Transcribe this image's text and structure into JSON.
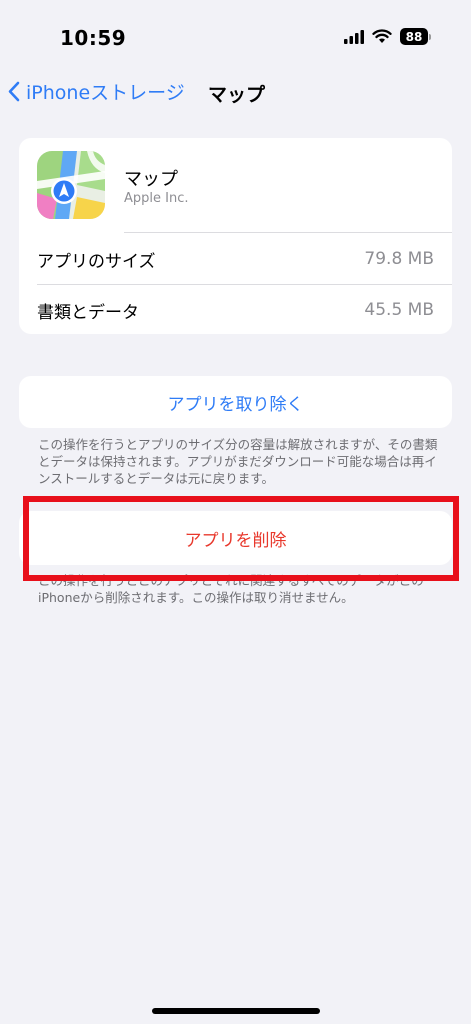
{
  "status_bar": {
    "time": "10:59",
    "battery_level": "88",
    "icons": [
      "cellular-signal-icon",
      "wifi-icon",
      "battery-icon"
    ]
  },
  "nav": {
    "back_label": "iPhoneストレージ",
    "title": "マップ"
  },
  "app": {
    "name": "マップ",
    "developer": "Apple Inc.",
    "icon": "maps-app-icon"
  },
  "info_rows": [
    {
      "label": "アプリのサイズ",
      "value": "79.8 MB"
    },
    {
      "label": "書類とデータ",
      "value": "45.5 MB"
    }
  ],
  "offload": {
    "button_label": "アプリを取り除く",
    "footnote": "この操作を行うとアプリのサイズ分の容量は解放されますが、その書類とデータは保持されます。アプリがまだダウンロード可能な場合は再インストールするとデータは元に戻ります。"
  },
  "delete": {
    "button_label": "アプリを削除",
    "footnote": "この操作を行うとこのアプリとそれに関連するすべてのデータがこのiPhoneから削除されます。この操作は取り消せません。"
  },
  "colors": {
    "accent_blue": "#2f7cf6",
    "destructive_red": "#e8382c",
    "highlight_red": "#e8101b",
    "background": "#f2f2f7"
  }
}
